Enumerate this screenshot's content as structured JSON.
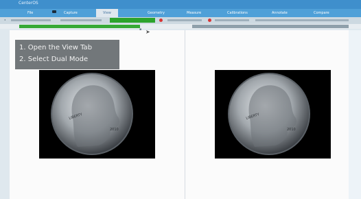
{
  "window": {
    "title": "CenterOS"
  },
  "menu": {
    "items": [
      "File",
      "Capture",
      "View",
      "Geometry",
      "Measure",
      "Calibrations",
      "Annotate",
      "Compare"
    ],
    "active": "View"
  },
  "instruction": {
    "line1": "1. Open the View Tab",
    "line2": "2. Select Dual Mode"
  },
  "images": [
    {
      "content": "Lincoln penny (obverse)",
      "year": "2010"
    },
    {
      "content": "Lincoln penny (obverse)",
      "year": "2010"
    }
  ],
  "colors": {
    "titlebar": "#3f8fcc",
    "menubar": "#4fa0d8",
    "progress_green": "#36a936",
    "toolbar_green": "#2ca32c",
    "record_red": "#d83434"
  }
}
